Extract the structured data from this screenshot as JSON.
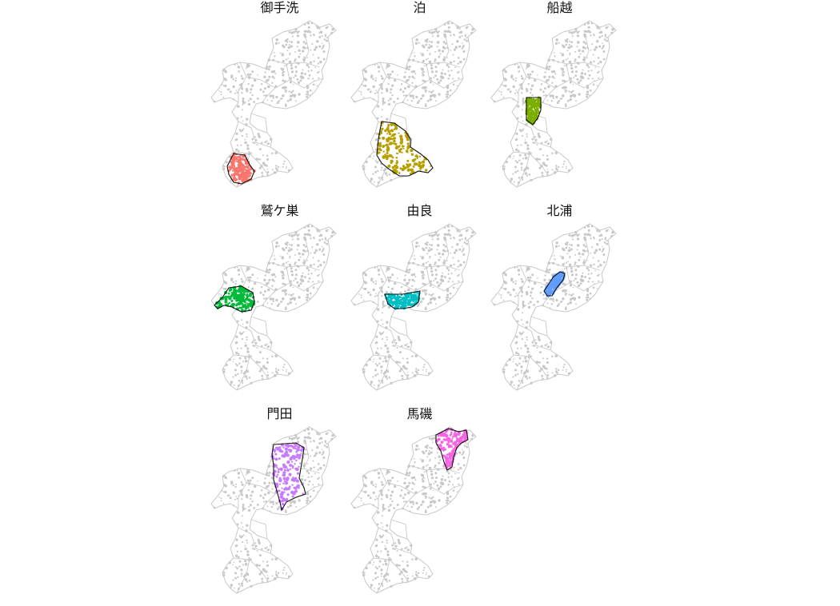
{
  "panels": [
    {
      "title": "御手洗",
      "highlight_region": "southwest",
      "color": "#f8766d"
    },
    {
      "title": "泊",
      "highlight_region": "south-central",
      "color": "#b79f00"
    },
    {
      "title": "船越",
      "highlight_region": "west-center",
      "color": "#7cae00"
    },
    {
      "title": "鷲ケ巣",
      "highlight_region": "west",
      "color": "#00ba38"
    },
    {
      "title": "由良",
      "highlight_region": "center",
      "color": "#00bfc4"
    },
    {
      "title": "北浦",
      "highlight_region": "north-center",
      "color": "#619cff"
    },
    {
      "title": "門田",
      "highlight_region": "north",
      "color": "#c77cff"
    },
    {
      "title": "馬磯",
      "highlight_region": "northeast",
      "color": "#f564e3"
    }
  ],
  "base_color": "#c8c8c8",
  "border_color": "#111111"
}
